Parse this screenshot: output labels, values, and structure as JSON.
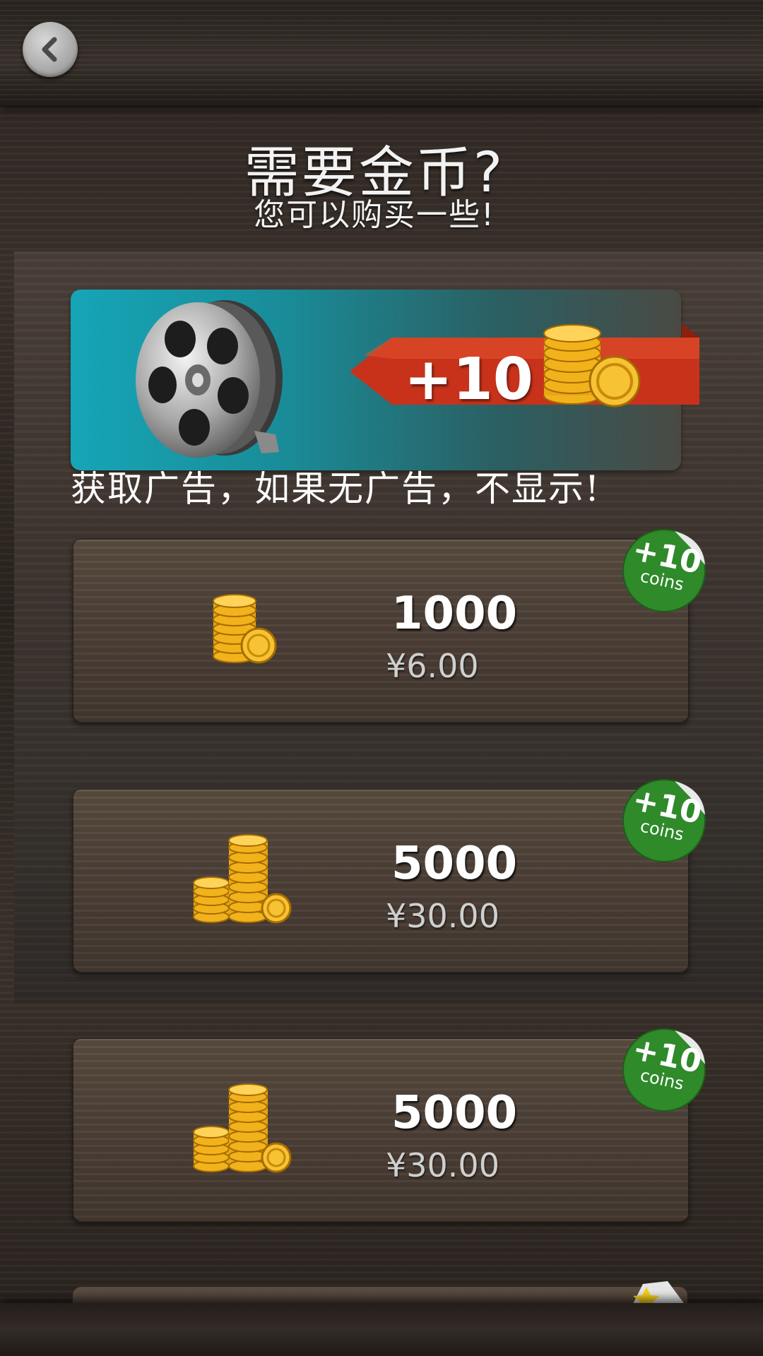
{
  "header": {
    "back_icon": "chevron-left-icon",
    "title": "需要金币?",
    "subtitle": "您可以购买一些!"
  },
  "video_offer": {
    "icon": "film-reel-icon",
    "reward_label": "+10",
    "coin_icon": "coin-stack-icon",
    "note": "获取广告，如果无广告，不显示!"
  },
  "packs": [
    {
      "amount": "1000",
      "price": "¥6.00",
      "badge_big": "+10",
      "badge_small": "coins"
    },
    {
      "amount": "5000",
      "price": "¥30.00",
      "badge_big": "+10",
      "badge_small": "coins"
    },
    {
      "amount": "5000",
      "price": "¥30.00",
      "badge_big": "+10",
      "badge_small": "coins"
    }
  ],
  "colors": {
    "banner_teal": "#16a5b7",
    "ribbon_red": "#c8321a",
    "badge_green": "#2f8a2a",
    "coin_gold": "#f2b21c"
  }
}
